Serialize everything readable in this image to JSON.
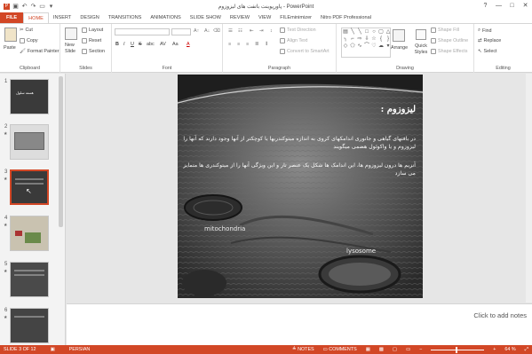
{
  "window": {
    "title": "پاورپوینت باتفت های لیزوزوم - PowerPoint",
    "controls": [
      "?",
      "—",
      "□",
      "✕"
    ]
  },
  "tabs": [
    "FILE",
    "HOME",
    "INSERT",
    "DESIGN",
    "TRANSITIONS",
    "ANIMATIONS",
    "SLIDE SHOW",
    "REVIEW",
    "VIEW",
    "FILEminimizer",
    "Nitro PDF Professional"
  ],
  "active_tab": "HOME",
  "ribbon": {
    "clipboard": {
      "paste": "Paste",
      "cut": "Cut",
      "copy": "Copy",
      "format_painter": "Format Painter",
      "label": "Clipboard"
    },
    "slides": {
      "new_slide": "New Slide",
      "layout": "Layout",
      "reset": "Reset",
      "section": "Section",
      "label": "Slides"
    },
    "font": {
      "bold": "B",
      "italic": "I",
      "underline": "U",
      "strike": "S",
      "shadow": "abc",
      "spacing": "AV",
      "case": "Aa",
      "color": "A",
      "label": "Font"
    },
    "paragraph": {
      "text_direction": "Text Direction",
      "align_text": "Align Text",
      "smartart": "Convert to SmartArt",
      "label": "Paragraph"
    },
    "drawing": {
      "arrange": "Arrange",
      "quick_styles": "Quick Styles",
      "shape_fill": "Shape Fill",
      "shape_outline": "Shape Outline",
      "shape_effects": "Shape Effects",
      "label": "Drawing"
    },
    "editing": {
      "find": "Find",
      "replace": "Replace",
      "select": "Select",
      "label": "Editing"
    }
  },
  "thumbnails": [
    {
      "num": "1",
      "star": "",
      "title": "ﻫﺴﺘﻪ ﺳﻠﻮﻝ"
    },
    {
      "num": "2",
      "star": "★",
      "title": ""
    },
    {
      "num": "3",
      "star": "★",
      "title": ""
    },
    {
      "num": "4",
      "star": "★",
      "title": ""
    },
    {
      "num": "5",
      "star": "★",
      "title": ""
    },
    {
      "num": "6",
      "star": "★",
      "title": ""
    }
  ],
  "slide": {
    "heading": "لیزوزوم :",
    "para1": "در بافتهای گیاهی و جانوری اندامکهای کروی  به اندازه میتوکندریها یا کوچکتر از آنها وجود دارند که آنها را لیزوزوم و یا واکوئول هضمی میگویند",
    "para2": "آنزیم ها درون لیزوزوم ها،  این اندامک ها شکل یک عنصر تار و این ویژگی آنها را از میتوکندری ها متمایز می سازد",
    "label_mito": "mitochondria",
    "label_lyso": "lysosome"
  },
  "notes_placeholder": "Click to add notes",
  "status": {
    "slide": "SLIDE 3 OF 12",
    "language": "PERSIAN",
    "notes": "NOTES",
    "comments": "COMMENTS",
    "zoom": "64 %"
  }
}
